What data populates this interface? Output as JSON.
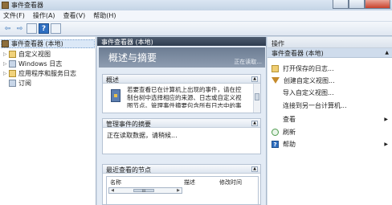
{
  "window": {
    "title": "事件查看器"
  },
  "menu": [
    "文件(F)",
    "操作(A)",
    "查看(V)",
    "帮助(H)"
  ],
  "toolbar": {
    "back": "⇦",
    "forward": "⇨",
    "help": "?"
  },
  "tree": {
    "root": "事件查看器 (本地)",
    "items": [
      "自定义视图",
      "Windows 日志",
      "应用程序和服务日志",
      "订阅"
    ]
  },
  "center": {
    "header": "事件查看器 (本地)",
    "banner_title": "概述与摘要",
    "banner_status": "正在读取...",
    "overview": {
      "title": "概述",
      "text": "若要查看已在计算机上出现的事件，请在控制台树中选择相应的来源、日志或自定义视图节点。管理事件摘要包含所有日志中的事件。"
    },
    "summary": {
      "title": "管理事件的摘要",
      "text": "正在读取数据，请稍候..."
    },
    "recent": {
      "title": "最近查看的节点",
      "col_name": "名称",
      "col_desc": "描述",
      "col_modified": "修改时间",
      "scroll_grip": "III"
    }
  },
  "actions": {
    "header": "操作",
    "section": "事件查看器 (本地)",
    "items": [
      "打开保存的日志...",
      "创建自定义视图...",
      "导入自定义视图...",
      "连接到另一台计算机...",
      "查看",
      "刷新",
      "帮助"
    ]
  }
}
